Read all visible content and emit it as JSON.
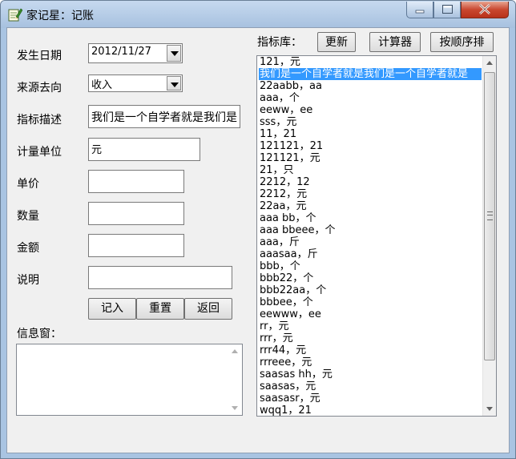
{
  "window": {
    "title": "家记星：记账",
    "icon": "notepad-pencil-icon"
  },
  "form": {
    "date_label": "发生日期",
    "date_value": "2012/11/27",
    "source_label": "来源去向",
    "source_value": "收入",
    "desc_label": "指标描述",
    "desc_value": "我们是一个自学者就是我们是",
    "unit_label": "计量单位",
    "unit_value": "元",
    "price_label": "单价",
    "price_value": "",
    "qty_label": "数量",
    "qty_value": "",
    "amount_label": "金额",
    "amount_value": "",
    "note_label": "说明",
    "note_value": ""
  },
  "buttons": {
    "record": "记入",
    "reset": "重置",
    "back": "返回"
  },
  "info": {
    "label": "信息窗：",
    "content": ""
  },
  "library": {
    "label": "指标库：",
    "refresh": "更新",
    "calculator": "计算器",
    "sort": "按顺序排",
    "items": [
      "121，元",
      "我们是一个自学者就是我们是一个自学者就是",
      "22aabb，aa",
      "aaa，个",
      "eeww，ee",
      "sss，元",
      "11，21",
      "121121，21",
      "121121，元",
      "21，只",
      "2212，12",
      "2212，元",
      "22aa，元",
      "aaa bb，个",
      "aaa bbeee，个",
      "aaa，斤",
      "aaasaa，斤",
      "bbb，个",
      "bbb22，个",
      "bbb22aa，个",
      "bbbee，个",
      "eewww，ee",
      "rr，元",
      "rrr，元",
      "rrr44，元",
      "rrreee，元",
      "saasas hh，元",
      "saasas，元",
      "saasasr，元",
      "wqq1，21"
    ],
    "selected_index": 1
  }
}
